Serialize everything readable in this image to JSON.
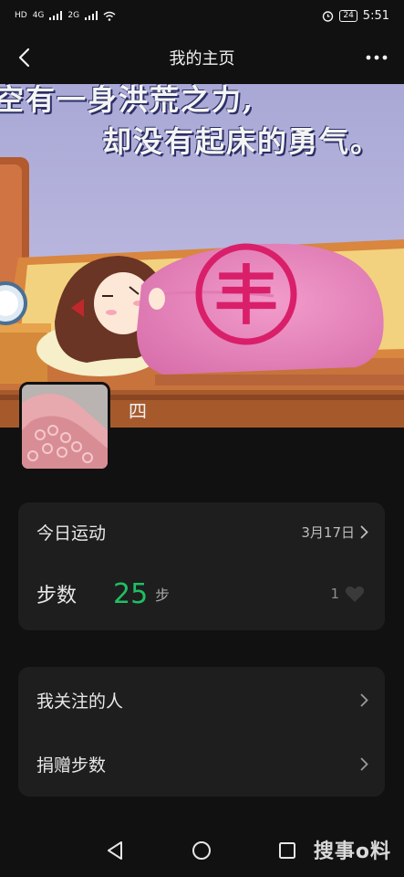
{
  "status_bar": {
    "hd_label": "HD",
    "net1": "4G",
    "net2": "2G",
    "battery": "24",
    "time": "5:51"
  },
  "nav": {
    "title": "我的主页"
  },
  "cover": {
    "line1": "空有一身洪荒之力,",
    "line2": "却没有起床的勇气。",
    "blanket_char": "丰"
  },
  "profile": {
    "name": "四"
  },
  "today": {
    "label": "今日运动",
    "date": "3月17日",
    "steps_label": "步数",
    "steps_value": "25",
    "steps_unit": "步",
    "likes": "1"
  },
  "menu": {
    "following_label": "我关注的人",
    "donate_label": "捐赠步数"
  },
  "watermark": "搜事o料",
  "colors": {
    "background": "#111111",
    "card": "#1e1e1e",
    "steps_green": "#1fbf63"
  },
  "icons": [
    "back-arrow-icon",
    "more-dots-icon",
    "chevron-right-icon",
    "heart-icon",
    "back-triangle-icon",
    "home-circle-icon",
    "recent-square-icon"
  ]
}
